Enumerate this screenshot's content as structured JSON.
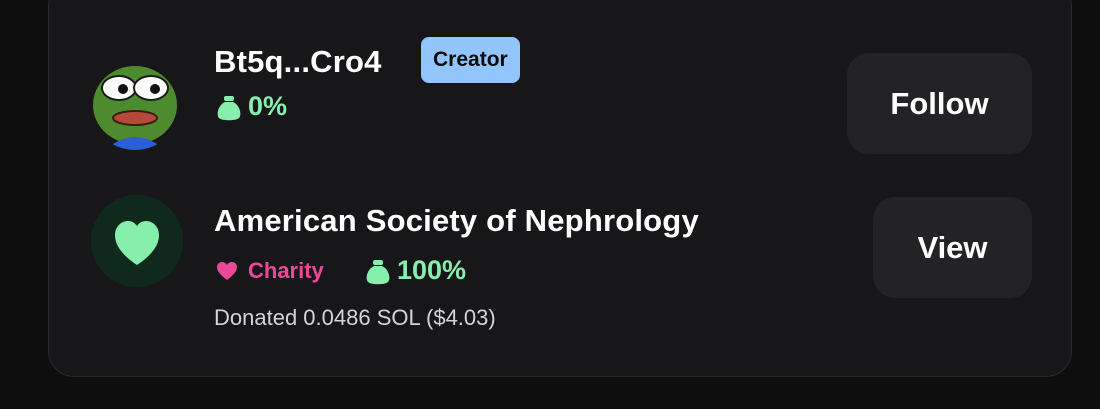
{
  "rows": [
    {
      "name": "Bt5q...Cro4",
      "badge": "Creator",
      "percent": "0%",
      "button_label": "Follow"
    },
    {
      "name": "American Society of Nephrology",
      "tag": "Charity",
      "percent": "100%",
      "donated_text": "Donated 0.0486 SOL ($4.03)",
      "button_label": "View"
    }
  ],
  "colors": {
    "badge_bg": "#93c5fd",
    "percent_green": "#86efac",
    "charity_pink": "#ec4899",
    "charity_avatar_bg": "#0f2a1c"
  },
  "icons": {
    "money_bag": "money-bag-icon",
    "charity_heart": "heart-icon",
    "creator_avatar": "frog-avatar",
    "charity_avatar": "heart-icon"
  }
}
